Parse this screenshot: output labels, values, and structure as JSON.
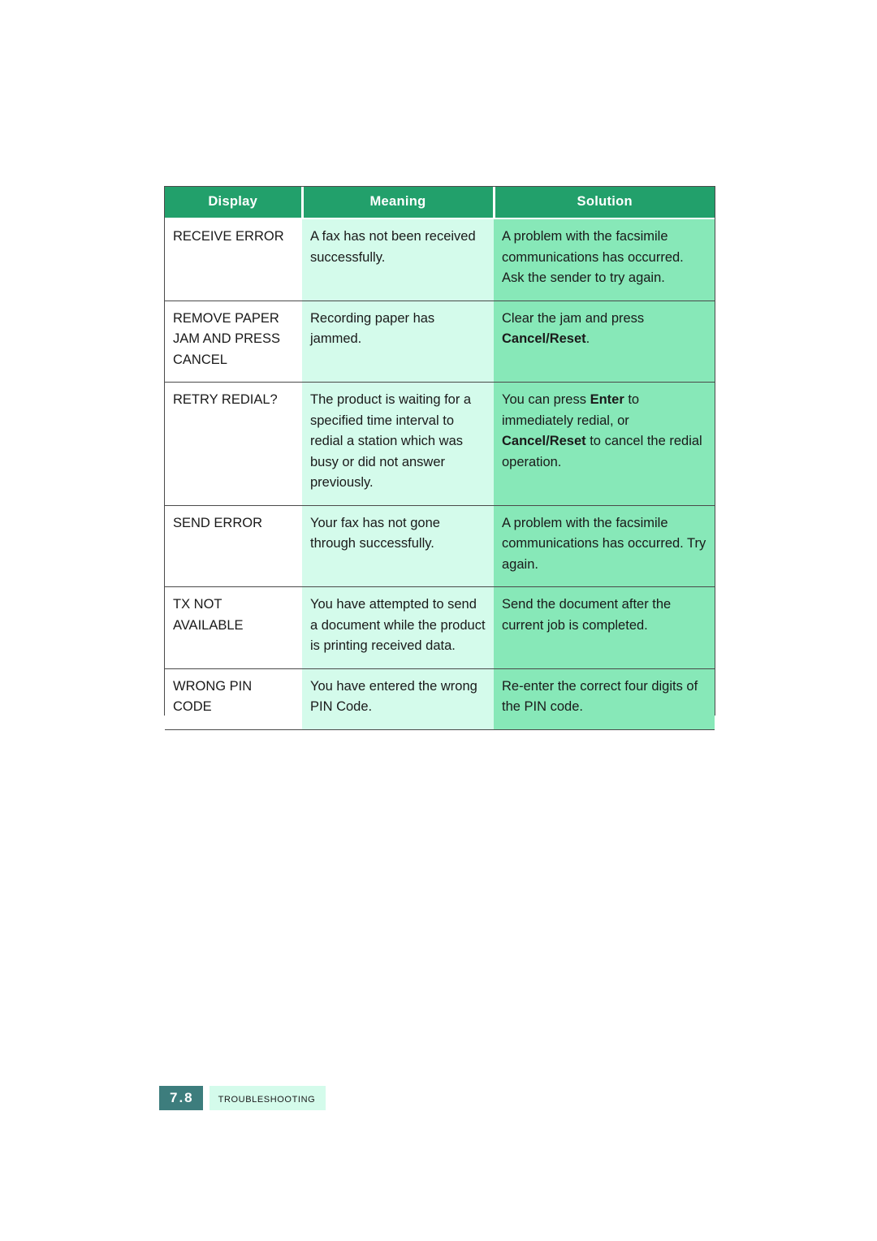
{
  "table": {
    "headers": [
      "Display",
      "Meaning",
      "Solution"
    ],
    "rows": [
      {
        "display": "RECEIVE ERROR",
        "meaning": "A fax has not been received successfully.",
        "solution_parts": [
          {
            "text": "A problem with the facsimile communications has occurred. Ask the sender to try again.",
            "bold": false
          }
        ]
      },
      {
        "display": "REMOVE PAPER JAM AND PRESS CANCEL",
        "meaning": "Recording paper has jammed.",
        "solution_parts": [
          {
            "text": "Clear the jam and press ",
            "bold": false
          },
          {
            "text": "Cancel/Reset",
            "bold": true
          },
          {
            "text": ".",
            "bold": false
          }
        ]
      },
      {
        "display": "RETRY REDIAL?",
        "meaning": "The product is waiting for a specified time interval to redial a station which was busy or did not answer previously.",
        "solution_parts": [
          {
            "text": "You can press ",
            "bold": false
          },
          {
            "text": "Enter",
            "bold": true
          },
          {
            "text": " to immediately redial, or ",
            "bold": false
          },
          {
            "text": "Cancel/Reset",
            "bold": true
          },
          {
            "text": " to cancel the redial operation.",
            "bold": false
          }
        ]
      },
      {
        "display": "SEND ERROR",
        "meaning": "Your fax has not gone through successfully.",
        "solution_parts": [
          {
            "text": "A problem with the facsimile communications has occurred. Try again.",
            "bold": false
          }
        ]
      },
      {
        "display": "TX NOT AVAILABLE",
        "meaning": "You have attempted to send a document while the product is printing received data.",
        "solution_parts": [
          {
            "text": "Send the document after the current job is completed.",
            "bold": false
          }
        ]
      },
      {
        "display": "WRONG PIN CODE",
        "meaning": "You have entered the wrong PIN Code.",
        "solution_parts": [
          {
            "text": "Re-enter the correct four digits of the PIN code.",
            "bold": false
          }
        ]
      }
    ]
  },
  "footer": {
    "page_number": "7.8",
    "chapter_label": "TROUBLESHOOTING"
  },
  "colors": {
    "header_green": "#22a06b",
    "solution_green": "#87e8b8",
    "meaning_mint": "#d4fbeb",
    "footer_teal": "#3d7d7d",
    "rule_gray": "#4a4a4a"
  }
}
